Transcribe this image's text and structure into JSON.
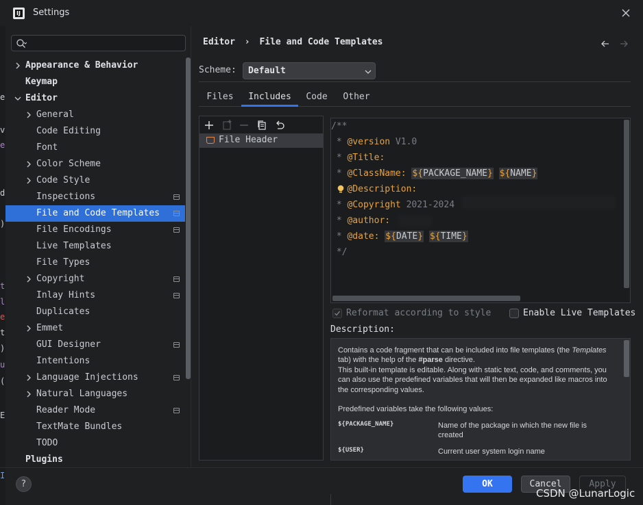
{
  "window": {
    "title": "Settings",
    "logo_text": "IJ"
  },
  "left_edge_glyphs": [
    {
      "ch": "e",
      "color": "#c9ccd1"
    },
    {
      "ch": "v",
      "color": "#c9ccd1"
    },
    {
      "ch": "e",
      "color": "#b27be0"
    },
    {
      "ch": "d.",
      "color": "#c9ccd1"
    },
    {
      "ch": ")",
      "color": "#c9ccd1"
    },
    {
      "ch": "t",
      "color": "#b27be0"
    },
    {
      "ch": "l",
      "color": "#b27be0"
    },
    {
      "ch": "e",
      "color": "#e05555"
    },
    {
      "ch": "t",
      "color": "#c9ccd1"
    },
    {
      "ch": ")",
      "color": "#c9ccd1"
    },
    {
      "ch": "u",
      "color": "#b27be0"
    },
    {
      "ch": "(",
      "color": "#c9ccd1"
    },
    {
      "ch": "E",
      "color": "#c9ccd1"
    },
    {
      "ch": "I",
      "color": "#6e9bd8"
    }
  ],
  "search": {
    "placeholder": "",
    "value": ""
  },
  "tree": [
    {
      "label": "Appearance & Behavior",
      "level": 0,
      "expandable": true,
      "expanded": false,
      "bold": true
    },
    {
      "label": "Keymap",
      "level": 0,
      "expandable": false,
      "bold": true
    },
    {
      "label": "Editor",
      "level": 0,
      "expandable": true,
      "expanded": true,
      "bold": true
    },
    {
      "label": "General",
      "level": 1,
      "expandable": true,
      "expanded": false
    },
    {
      "label": "Code Editing",
      "level": 1
    },
    {
      "label": "Font",
      "level": 1
    },
    {
      "label": "Color Scheme",
      "level": 1,
      "expandable": true,
      "expanded": false
    },
    {
      "label": "Code Style",
      "level": 1,
      "expandable": true,
      "expanded": false
    },
    {
      "label": "Inspections",
      "level": 1,
      "project": true
    },
    {
      "label": "File and Code Templates",
      "level": 1,
      "project": true,
      "selected": true
    },
    {
      "label": "File Encodings",
      "level": 1,
      "project": true
    },
    {
      "label": "Live Templates",
      "level": 1
    },
    {
      "label": "File Types",
      "level": 1
    },
    {
      "label": "Copyright",
      "level": 1,
      "expandable": true,
      "expanded": false,
      "project": true
    },
    {
      "label": "Inlay Hints",
      "level": 1,
      "project": true
    },
    {
      "label": "Duplicates",
      "level": 1
    },
    {
      "label": "Emmet",
      "level": 1,
      "expandable": true,
      "expanded": false
    },
    {
      "label": "GUI Designer",
      "level": 1,
      "project": true
    },
    {
      "label": "Intentions",
      "level": 1
    },
    {
      "label": "Language Injections",
      "level": 1,
      "expandable": true,
      "expanded": false,
      "project": true
    },
    {
      "label": "Natural Languages",
      "level": 1,
      "expandable": true,
      "expanded": false
    },
    {
      "label": "Reader Mode",
      "level": 1,
      "project": true
    },
    {
      "label": "TextMate Bundles",
      "level": 1
    },
    {
      "label": "TODO",
      "level": 1
    },
    {
      "label": "Plugins",
      "level": 0,
      "bold": true
    }
  ],
  "breadcrumb": {
    "parent": "Editor",
    "separator": "›",
    "current": "File and Code Templates"
  },
  "scheme": {
    "label": "Scheme:",
    "value": "Default"
  },
  "tabs": [
    "Files",
    "Includes",
    "Code",
    "Other"
  ],
  "active_tab": "Includes",
  "templates": {
    "items": [
      "File Header"
    ]
  },
  "editor_lines": [
    [
      {
        "t": "/**",
        "c": "c-com"
      }
    ],
    [
      {
        "t": " * ",
        "c": "c-com"
      },
      {
        "t": "@version",
        "c": "c-tag"
      },
      {
        "t": " V1.0",
        "c": "c-val"
      }
    ],
    [
      {
        "t": " * ",
        "c": "c-com"
      },
      {
        "t": "@Title:",
        "c": "c-tag"
      }
    ],
    [
      {
        "t": " * ",
        "c": "c-com"
      },
      {
        "t": "@ClassName:",
        "c": "c-tag"
      },
      {
        "t": " ",
        "c": "c-com"
      },
      {
        "t": "${PACKAGE_NAME}",
        "c": "var"
      },
      {
        "t": " ",
        "c": "c-com"
      },
      {
        "t": "${NAME}",
        "c": "var"
      }
    ],
    [
      {
        "t": "   ",
        "c": "c-com"
      },
      {
        "t": "@Description:",
        "c": "c-tag"
      }
    ],
    [
      {
        "t": " * ",
        "c": "c-com"
      },
      {
        "t": "@Copyright",
        "c": "c-tag"
      },
      {
        "t": " 2021-2024",
        "c": "c-val"
      }
    ],
    [
      {
        "t": " * ",
        "c": "c-com"
      },
      {
        "t": "@author:",
        "c": "c-tag"
      }
    ],
    [
      {
        "t": " * ",
        "c": "c-com"
      },
      {
        "t": "@date:",
        "c": "c-tag"
      },
      {
        "t": " ",
        "c": "c-com"
      },
      {
        "t": "${DATE}",
        "c": "var"
      },
      {
        "t": " ",
        "c": "c-com"
      },
      {
        "t": "${TIME}",
        "c": "var"
      }
    ],
    [
      {
        "t": " */",
        "c": "c-com"
      }
    ]
  ],
  "options": {
    "reformat": {
      "label": "Reformat according to style",
      "checked": true,
      "enabled": false
    },
    "live_templates": {
      "label": "Enable Live Templates",
      "checked": false,
      "enabled": true
    }
  },
  "description": {
    "label": "Description:",
    "p1_a": "Contains a code fragment that can be included into file templates (the ",
    "p1_em": "Templates",
    "p1_b": " tab) with the help of the ",
    "p1_strong": "#parse",
    "p1_c": " directive.",
    "p2": "This built-in template is editable. Along with static text, code, and comments, you can also use the predefined variables that will then be expanded like macros into the corresponding values.",
    "p3": "Predefined variables take the following values:",
    "vars": [
      {
        "name": "${PACKAGE_NAME}",
        "desc": "Name of the package in which the new file is created"
      },
      {
        "name": "${USER}",
        "desc": "Current user system login name"
      }
    ]
  },
  "buttons": {
    "help": "?",
    "ok": "OK",
    "cancel": "Cancel",
    "apply": "Apply"
  },
  "watermark": "CSDN @LunarLogic",
  "colors": {
    "accent": "#3574f0",
    "selection": "#2e6fd8",
    "tag": "#e8a33d",
    "background": "#1f2022"
  }
}
